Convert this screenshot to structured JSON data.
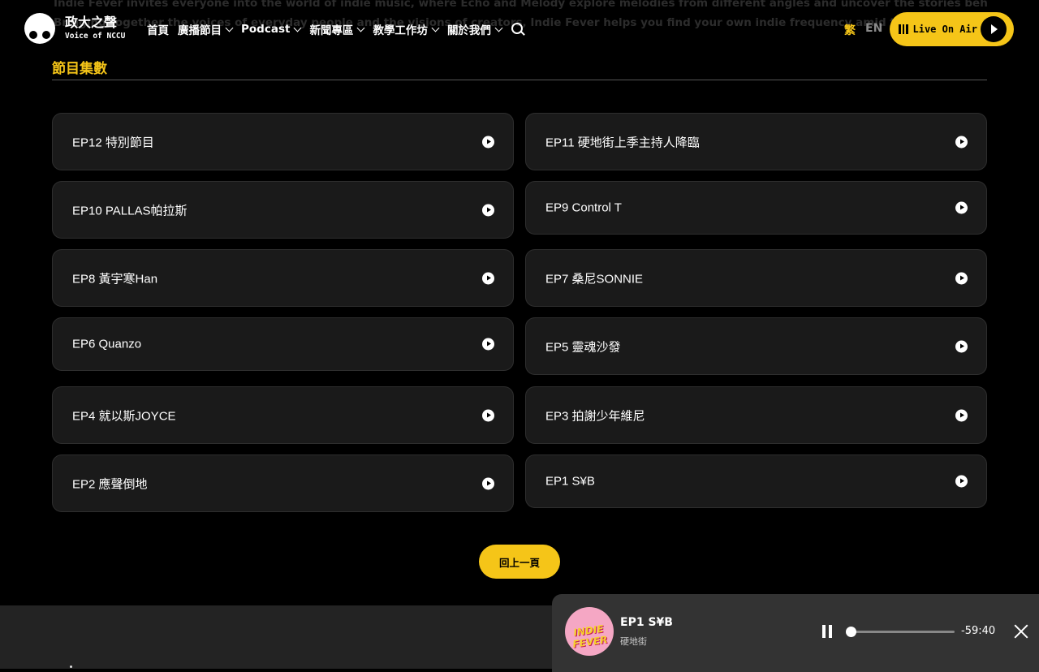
{
  "intro": {
    "line1": "Indie Fever invites everyone into the world of indie music, where Echo and Melody explore melodies from different angles and uncover the stories behind them.",
    "line2": "Bringing together the voices of everyday people and the visions of creators, Indie Fever helps you find your own indie frequency amid the noise."
  },
  "header": {
    "logo_title": "政大之聲",
    "logo_subtitle": "Voice of NCCU",
    "nav": [
      {
        "label": "首頁",
        "has_dropdown": false
      },
      {
        "label": "廣播節目",
        "has_dropdown": true
      },
      {
        "label": "Podcast",
        "has_dropdown": true
      },
      {
        "label": "新聞專區",
        "has_dropdown": true
      },
      {
        "label": "教學工作坊",
        "has_dropdown": true
      },
      {
        "label": "關於我們",
        "has_dropdown": true
      }
    ],
    "lang_zh": "繁",
    "lang_en": "EN",
    "live_label": "Live On Air"
  },
  "section": {
    "title": "節目集數",
    "episodes": [
      {
        "title": "EP12 特別節目"
      },
      {
        "title": "EP11 硬地街上季主持人降臨"
      },
      {
        "title": "EP10 PALLAS帕拉斯"
      },
      {
        "title": "EP9 Control T"
      },
      {
        "title": "EP8 黃宇寒Han"
      },
      {
        "title": "EP7 桑尼SONNIE"
      },
      {
        "title": "EP6 Quanzo"
      },
      {
        "title": "EP5 靈魂沙發"
      },
      {
        "title": "EP4 就以斯JOYCE"
      },
      {
        "title": "EP3 拍謝少年維尼"
      },
      {
        "title": "EP2 應聲倒地"
      },
      {
        "title": "EP1 S¥B"
      }
    ]
  },
  "back_label": "回上一頁",
  "player": {
    "cover_text": "INDIE FEVER",
    "title": "EP1 S¥B",
    "subtitle": "硬地街",
    "time_remaining": "-59:40",
    "progress": 0.0
  },
  "colors": {
    "accent": "#f5c518",
    "card_bg": "#1a1a1a",
    "player_bg": "#333333"
  }
}
